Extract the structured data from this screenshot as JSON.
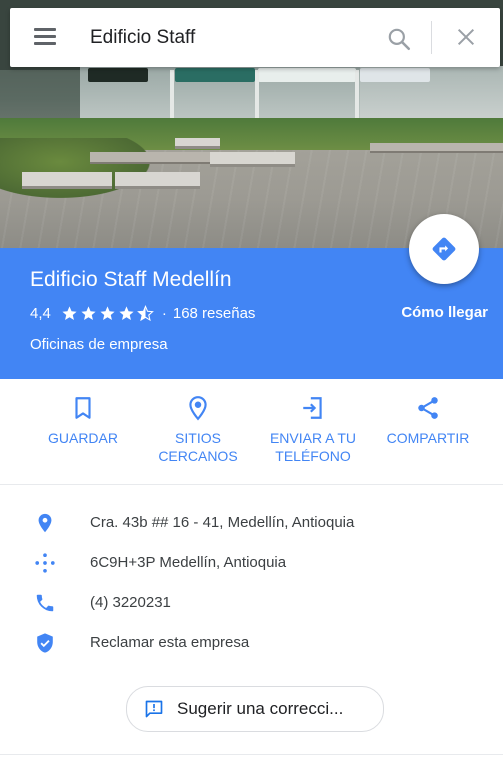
{
  "search": {
    "query": "Edificio Staff"
  },
  "place": {
    "title": "Edificio Staff Medellín",
    "rating": "4,4",
    "stars": 4.5,
    "reviews": "168 reseñas",
    "separator": "·",
    "category": "Oficinas de empresa",
    "directions_label": "Cómo llegar"
  },
  "actions": [
    {
      "label": "GUARDAR",
      "icon": "bookmark-icon"
    },
    {
      "label": "SITIOS CERCANOS",
      "icon": "nearby-icon"
    },
    {
      "label": "ENVIAR A TU TELÉFONO",
      "icon": "send-to-phone-icon"
    },
    {
      "label": "COMPARTIR",
      "icon": "share-icon"
    }
  ],
  "info": {
    "address": "Cra. 43b ## 16 - 41, Medellín, Antioquia",
    "plus_code": "6C9H+3P Medellín, Antioquia",
    "phone": "(4) 3220231",
    "claim": "Reclamar esta empresa"
  },
  "suggest_label": "Sugerir una correcci...",
  "colors": {
    "accent": "#4285f4",
    "text": "#3c4043",
    "icon_gray": "#5f6368"
  }
}
